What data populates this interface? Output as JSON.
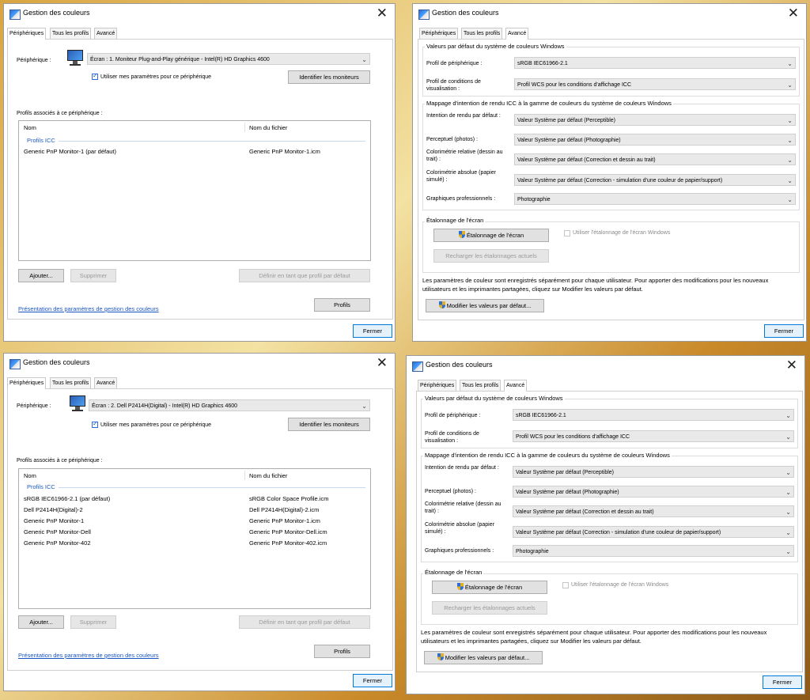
{
  "common": {
    "title": "Gestion des couleurs",
    "tabs": [
      "Périphériques",
      "Tous les profils",
      "Avancé"
    ],
    "close_label": "Fermer"
  },
  "devices": {
    "device_label": "Périphérique :",
    "use_my_settings": "Utiliser mes paramètres pour ce périphérique",
    "identify": "Identifier les moniteurs",
    "assoc": "Profils associés à ce périphérique :",
    "col_name": "Nom",
    "col_file": "Nom du fichier",
    "group": "Profils ICC",
    "add": "Ajouter...",
    "remove": "Supprimer",
    "set_default": "Définir en tant que profil par défaut",
    "overview": "Présentation des paramètres de gestion des couleurs",
    "profiles": "Profils"
  },
  "d1": {
    "device_value": "Écran : 1. Moniteur Plug-and-Play générique - Intel(R) HD Graphics 4600",
    "rows": [
      {
        "name": "Generic PnP Monitor-1 (par défaut)",
        "file": "Generic PnP Monitor-1.icm"
      }
    ]
  },
  "d2": {
    "device_value": "Écran : 2. Dell P2414H(Digital) - Intel(R) HD Graphics 4600",
    "rows": [
      {
        "name": "sRGB IEC61966-2.1 (par défaut)",
        "file": "sRGB Color Space Profile.icm"
      },
      {
        "name": "Dell P2414H(Digital)-2",
        "file": "Dell P2414H(Digital)-2.icm"
      },
      {
        "name": "Generic PnP Monitor-1",
        "file": "Generic PnP Monitor-1.icm"
      },
      {
        "name": "Generic PnP Monitor-Dell",
        "file": "Generic PnP Monitor-Dell.icm"
      },
      {
        "name": "Generic PnP Monitor-402",
        "file": "Generic PnP Monitor-402.icm"
      }
    ]
  },
  "adv": {
    "defaults_title": "Valeurs par défaut du système de couleurs Windows",
    "device_profile_label": "Profil de périphérique :",
    "device_profile_value": "sRGB IEC61966-2.1",
    "viewing_label": "Profil de conditions de visualisation :",
    "viewing_value": "Profil WCS pour les conditions d'affichage ICC",
    "mapping_title": "Mappage d'intention de rendu ICC à la gamme de couleurs du système de couleurs Windows",
    "intent_label": "Intention de rendu par défaut :",
    "intent_value": "Valeur Système par défaut (Perceptible)",
    "perceptual_label": "Perceptuel (photos) :",
    "perceptual_value": "Valeur Système par défaut (Photographie)",
    "relative_label": "Colorimétrie relative (dessin au trait) :",
    "relative_value": "Valeur Système par défaut (Correction et dessin au trait)",
    "absolute_label": "Colorimétrie absolue (papier simulé) :",
    "absolute_value": "Valeur Système par défaut (Correction - simulation d'une couleur de papier/support)",
    "business_label": "Graphiques professionnels :",
    "business_value": "Photographie",
    "calib_title": "Étalonnage de l'écran",
    "calib_button": "Étalonnage de l'écran",
    "use_windows_calib": "Utiliser l'étalonnage de l'écran Windows",
    "reload_calib": "Recharger les étalonnages actuels",
    "note": "Les paramètres de couleur sont enregistrés séparément pour chaque utilisateur. Pour apporter des modifications pour les nouveaux utilisateurs et les imprimantes partagées, cliquez sur Modifier les valeurs par défaut.",
    "change_defaults": "Modifier les valeurs par défaut..."
  },
  "colors": {
    "link": "#1a55c4",
    "group": "#1e5bbf",
    "primary_border": "#0078d7"
  }
}
